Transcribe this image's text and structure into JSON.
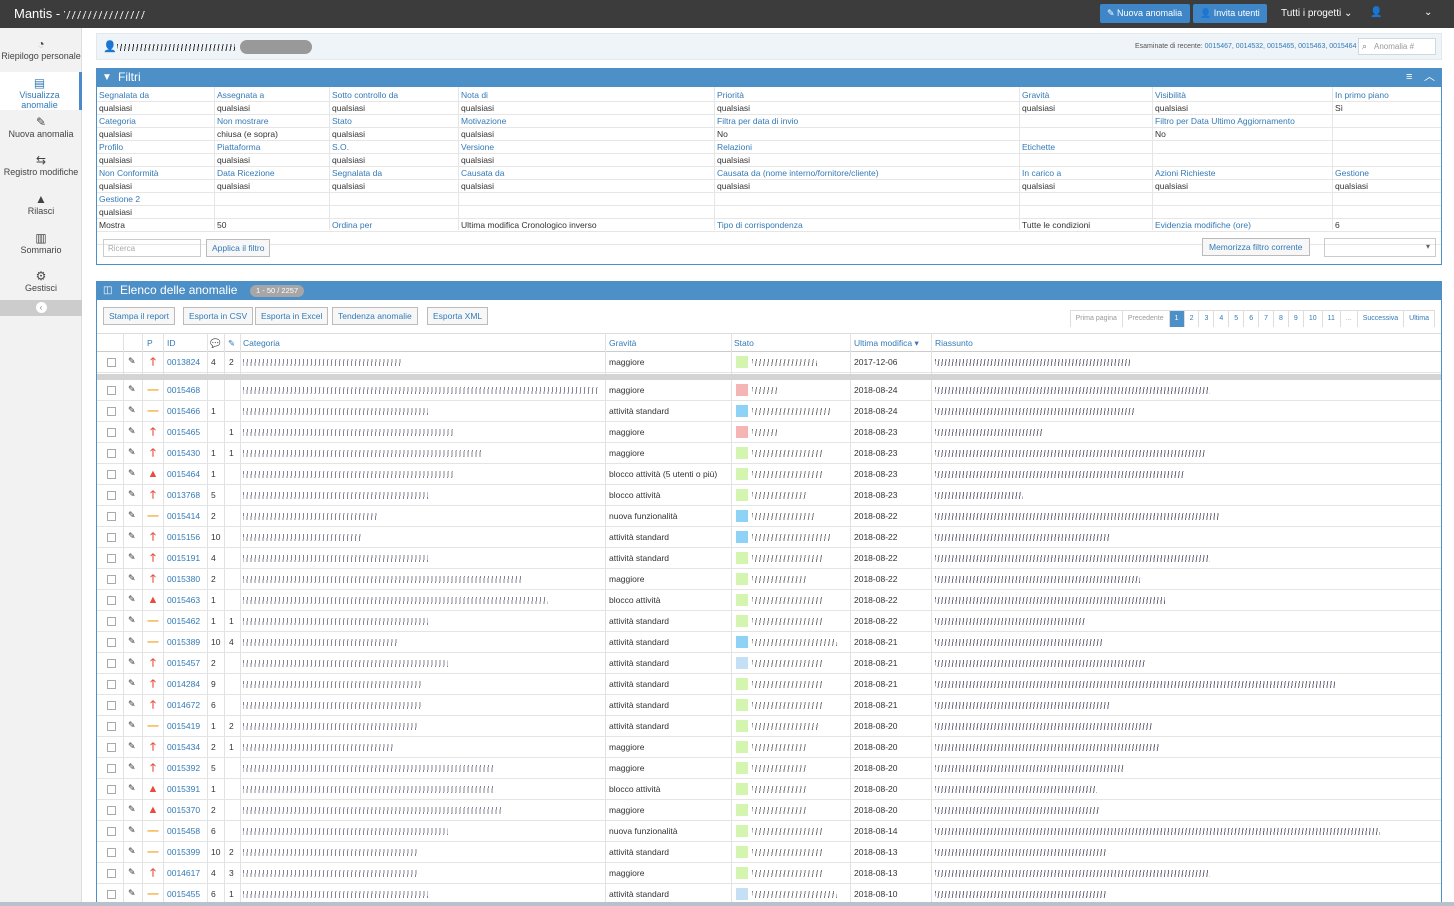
{
  "app": {
    "brand": "Mantis -",
    "new_issue_label": "Nuova anomalia",
    "invite_label": "Invita utenti",
    "projects_label": "Tutti i progetti",
    "user_icon": "user-icon"
  },
  "sidebar": {
    "items": [
      {
        "label": "Riepilogo personale",
        "icon": "dashboard-icon",
        "glyph": "◔"
      },
      {
        "label": "Visualizza anomalie",
        "icon": "list-icon",
        "glyph": "▤"
      },
      {
        "label": "Nuova anomalia",
        "icon": "edit-icon",
        "glyph": "✎"
      },
      {
        "label": "Registro modifiche",
        "icon": "retweet-icon",
        "glyph": "⇆"
      },
      {
        "label": "Rilasci",
        "icon": "road-icon",
        "glyph": "▲"
      },
      {
        "label": "Sommario",
        "icon": "bar-chart-icon",
        "glyph": "▥"
      },
      {
        "label": "Gestisci",
        "icon": "gears-icon",
        "glyph": "⚙"
      }
    ]
  },
  "breadcrumb": {
    "recent_label": "Esaminate di recente:",
    "recent_ids": "0015467, 0014532, 0015465, 0015463, 0015464",
    "search_placeholder": "Anomalia #"
  },
  "filters": {
    "title": "Filtri",
    "rows": [
      [
        [
          "Segnalata da",
          "qualsiasi"
        ],
        [
          "Assegnata a",
          "qualsiasi"
        ],
        [
          "Sotto controllo da",
          "qualsiasi"
        ],
        [
          "Nota di",
          "qualsiasi"
        ],
        [
          "Priorità",
          "qualsiasi"
        ],
        [
          "Gravità",
          "qualsiasi"
        ],
        [
          "Visibilità",
          "qualsiasi"
        ],
        [
          "In primo piano",
          "Sì"
        ]
      ],
      [
        [
          "Categoria",
          "qualsiasi"
        ],
        [
          "Non mostrare",
          "chiusa (e sopra)"
        ],
        [
          "Stato",
          "qualsiasi"
        ],
        [
          "Motivazione",
          "qualsiasi"
        ],
        [
          "Filtra per data di invio",
          "No"
        ],
        [
          "",
          ""
        ],
        [
          "Filtro per Data Ultimo Aggiornamento",
          "No"
        ],
        [
          "",
          ""
        ]
      ],
      [
        [
          "Profilo",
          "qualsiasi"
        ],
        [
          "Piattaforma",
          "qualsiasi"
        ],
        [
          "S.O.",
          "qualsiasi"
        ],
        [
          "Versione",
          "qualsiasi"
        ],
        [
          "Relazioni",
          "qualsiasi"
        ],
        [
          "Etichette",
          ""
        ],
        [
          "",
          ""
        ],
        [
          "",
          ""
        ]
      ],
      [
        [
          "Non Conformità",
          "qualsiasi"
        ],
        [
          "Data Ricezione",
          "qualsiasi"
        ],
        [
          "Segnalata da",
          "qualsiasi"
        ],
        [
          "Causata da",
          "qualsiasi"
        ],
        [
          "Causata da (nome interno/fornitore/cliente)",
          "qualsiasi"
        ],
        [
          "In carico a",
          "qualsiasi"
        ],
        [
          "Azioni Richieste",
          "qualsiasi"
        ],
        [
          "Gestione",
          "qualsiasi"
        ]
      ],
      [
        [
          "Gestione 2",
          "qualsiasi"
        ],
        [
          "",
          ""
        ],
        [
          "",
          ""
        ],
        [
          "",
          ""
        ],
        [
          "",
          ""
        ],
        [
          "",
          ""
        ],
        [
          "",
          ""
        ],
        [
          "",
          ""
        ]
      ]
    ],
    "last_row": {
      "show_label": "Mostra",
      "show_value": "50",
      "sort_label": "Ordina per",
      "sort_value": "Ultima modifica Cronologico inverso",
      "match_label": "Tipo di corrispondenza",
      "match_value": "Tutte le condizioni",
      "highlight_label": "Evidenzia modifiche (ore)",
      "highlight_value": "6"
    },
    "search_placeholder": "Ricerca",
    "apply_label": "Applica il filtro",
    "save_label": "Memorizza filtro corrente"
  },
  "list": {
    "title": "Elenco delle anomalie",
    "count": "1 - 50 / 2257",
    "actions": [
      "Stampa il report",
      "Esporta in CSV",
      "Esporta in Excel",
      "Tendenza anomalie",
      "Esporta XML"
    ],
    "pager": [
      "Prima pagina",
      "Precedente",
      "1",
      "2",
      "3",
      "4",
      "5",
      "6",
      "7",
      "8",
      "9",
      "10",
      "11",
      "...",
      "Successiva",
      "Ultima"
    ],
    "columns": {
      "p": "P",
      "id": "ID",
      "category": "Categoria",
      "severity": "Gravità",
      "status": "Stato",
      "updated": "Ultima modifica",
      "summary": "Riassunto"
    },
    "rows": [
      {
        "id": "0013824",
        "notes": "4",
        "attach": "2",
        "priority": "high",
        "severity": "maggiore",
        "status_color": "#d4f5b0",
        "updated": "2017-12-06"
      },
      {
        "id": "0015468",
        "notes": "",
        "attach": "",
        "priority": "normal",
        "severity": "maggiore",
        "status_color": "#f5b5b5",
        "updated": "2018-08-24"
      },
      {
        "id": "0015466",
        "notes": "1",
        "attach": "",
        "priority": "normal",
        "severity": "attività standard",
        "status_color": "#8ed3f5",
        "updated": "2018-08-24"
      },
      {
        "id": "0015465",
        "notes": "",
        "attach": "1",
        "priority": "high",
        "severity": "maggiore",
        "status_color": "#f5b5b5",
        "updated": "2018-08-23"
      },
      {
        "id": "0015430",
        "notes": "1",
        "attach": "1",
        "priority": "high",
        "severity": "maggiore",
        "status_color": "#d4f5b0",
        "updated": "2018-08-23"
      },
      {
        "id": "0015464",
        "notes": "1",
        "attach": "",
        "priority": "urgent",
        "severity": "blocco attività (5 utenti o più)",
        "status_color": "#d4f5b0",
        "updated": "2018-08-23"
      },
      {
        "id": "0013768",
        "notes": "5",
        "attach": "",
        "priority": "high",
        "severity": "blocco attività",
        "status_color": "#d4f5b0",
        "updated": "2018-08-23"
      },
      {
        "id": "0015414",
        "notes": "2",
        "attach": "",
        "priority": "normal",
        "severity": "nuova funzionalità",
        "status_color": "#8ed3f5",
        "updated": "2018-08-22"
      },
      {
        "id": "0015156",
        "notes": "10",
        "attach": "",
        "priority": "high",
        "severity": "attività standard",
        "status_color": "#8ed3f5",
        "updated": "2018-08-22"
      },
      {
        "id": "0015191",
        "notes": "4",
        "attach": "",
        "priority": "high",
        "severity": "attività standard",
        "status_color": "#d4f5b0",
        "updated": "2018-08-22"
      },
      {
        "id": "0015380",
        "notes": "2",
        "attach": "",
        "priority": "high",
        "severity": "maggiore",
        "status_color": "#d4f5b0",
        "updated": "2018-08-22"
      },
      {
        "id": "0015463",
        "notes": "1",
        "attach": "",
        "priority": "urgent",
        "severity": "blocco attività",
        "status_color": "#d4f5b0",
        "updated": "2018-08-22"
      },
      {
        "id": "0015462",
        "notes": "1",
        "attach": "1",
        "priority": "normal",
        "severity": "attività standard",
        "status_color": "#d4f5b0",
        "updated": "2018-08-22"
      },
      {
        "id": "0015389",
        "notes": "10",
        "attach": "4",
        "priority": "normal",
        "severity": "attività standard",
        "status_color": "#8ed3f5",
        "updated": "2018-08-21"
      },
      {
        "id": "0015457",
        "notes": "2",
        "attach": "",
        "priority": "high",
        "severity": "attività standard",
        "status_color": "#c5e0f5",
        "updated": "2018-08-21"
      },
      {
        "id": "0014284",
        "notes": "9",
        "attach": "",
        "priority": "high",
        "severity": "attività standard",
        "status_color": "#d4f5b0",
        "updated": "2018-08-21"
      },
      {
        "id": "0014672",
        "notes": "6",
        "attach": "",
        "priority": "high",
        "severity": "attività standard",
        "status_color": "#d4f5b0",
        "updated": "2018-08-21"
      },
      {
        "id": "0015419",
        "notes": "1",
        "attach": "2",
        "priority": "normal",
        "severity": "attività standard",
        "status_color": "#d4f5b0",
        "updated": "2018-08-20"
      },
      {
        "id": "0015434",
        "notes": "2",
        "attach": "1",
        "priority": "high",
        "severity": "maggiore",
        "status_color": "#d4f5b0",
        "updated": "2018-08-20"
      },
      {
        "id": "0015392",
        "notes": "5",
        "attach": "",
        "priority": "high",
        "severity": "maggiore",
        "status_color": "#d4f5b0",
        "updated": "2018-08-20"
      },
      {
        "id": "0015391",
        "notes": "1",
        "attach": "",
        "priority": "urgent",
        "severity": "blocco attività",
        "status_color": "#d4f5b0",
        "updated": "2018-08-20"
      },
      {
        "id": "0015370",
        "notes": "2",
        "attach": "",
        "priority": "urgent",
        "severity": "maggiore",
        "status_color": "#d4f5b0",
        "updated": "2018-08-20"
      },
      {
        "id": "0015458",
        "notes": "6",
        "attach": "",
        "priority": "normal",
        "severity": "nuova funzionalità",
        "status_color": "#d4f5b0",
        "updated": "2018-08-14"
      },
      {
        "id": "0015399",
        "notes": "10",
        "attach": "2",
        "priority": "normal",
        "severity": "attività standard",
        "status_color": "#d4f5b0",
        "updated": "2018-08-13"
      },
      {
        "id": "0014617",
        "notes": "4",
        "attach": "3",
        "priority": "high",
        "severity": "maggiore",
        "status_color": "#d4f5b0",
        "updated": "2018-08-13"
      },
      {
        "id": "0015455",
        "notes": "6",
        "attach": "1",
        "priority": "normal",
        "severity": "attività standard",
        "status_color": "#c5e0f5",
        "updated": "2018-08-10"
      }
    ]
  }
}
